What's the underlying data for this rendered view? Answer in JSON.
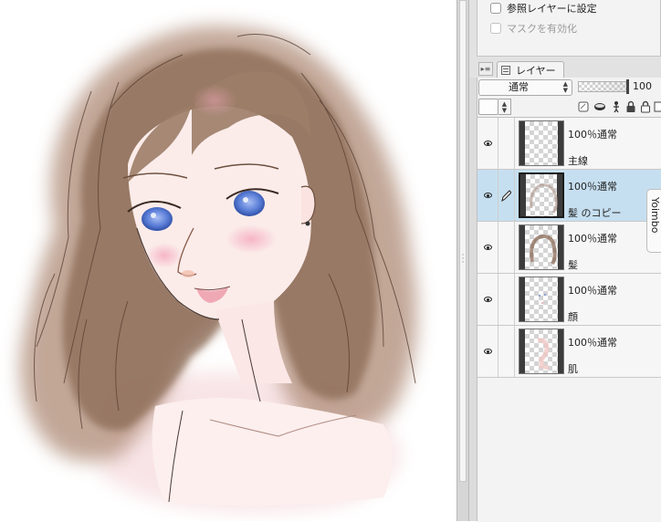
{
  "reference_props": {
    "reference_layer_label": "参照レイヤーに設定",
    "enable_mask_label": "マスクを有効化"
  },
  "layer_tab": {
    "label": "レイヤー"
  },
  "toolbar": {
    "blend_mode": "通常",
    "opacity_value": "100",
    "opacity_fraction": 1.0
  },
  "layers": [
    {
      "line1": "100％通常",
      "name": "主線",
      "selected": false,
      "editing": false
    },
    {
      "line1": "100％通常",
      "name": "髪 のコピー",
      "selected": true,
      "editing": true
    },
    {
      "line1": "100％通常",
      "name": "髪",
      "selected": false,
      "editing": false
    },
    {
      "line1": "100％通常",
      "name": "顔",
      "selected": false,
      "editing": false
    },
    {
      "line1": "100％通常",
      "name": "肌",
      "selected": false,
      "editing": false
    }
  ],
  "side_tab": {
    "label": "Yoimbo"
  },
  "colors": {
    "selected_row": "#c6dff0",
    "hair": "#8a6a55",
    "eyes": "#5a7fd6",
    "cheek": "#f2b6c4"
  },
  "icons": {
    "visibility": "eye-icon",
    "edit": "pen-icon",
    "lock": "lock-icon"
  }
}
